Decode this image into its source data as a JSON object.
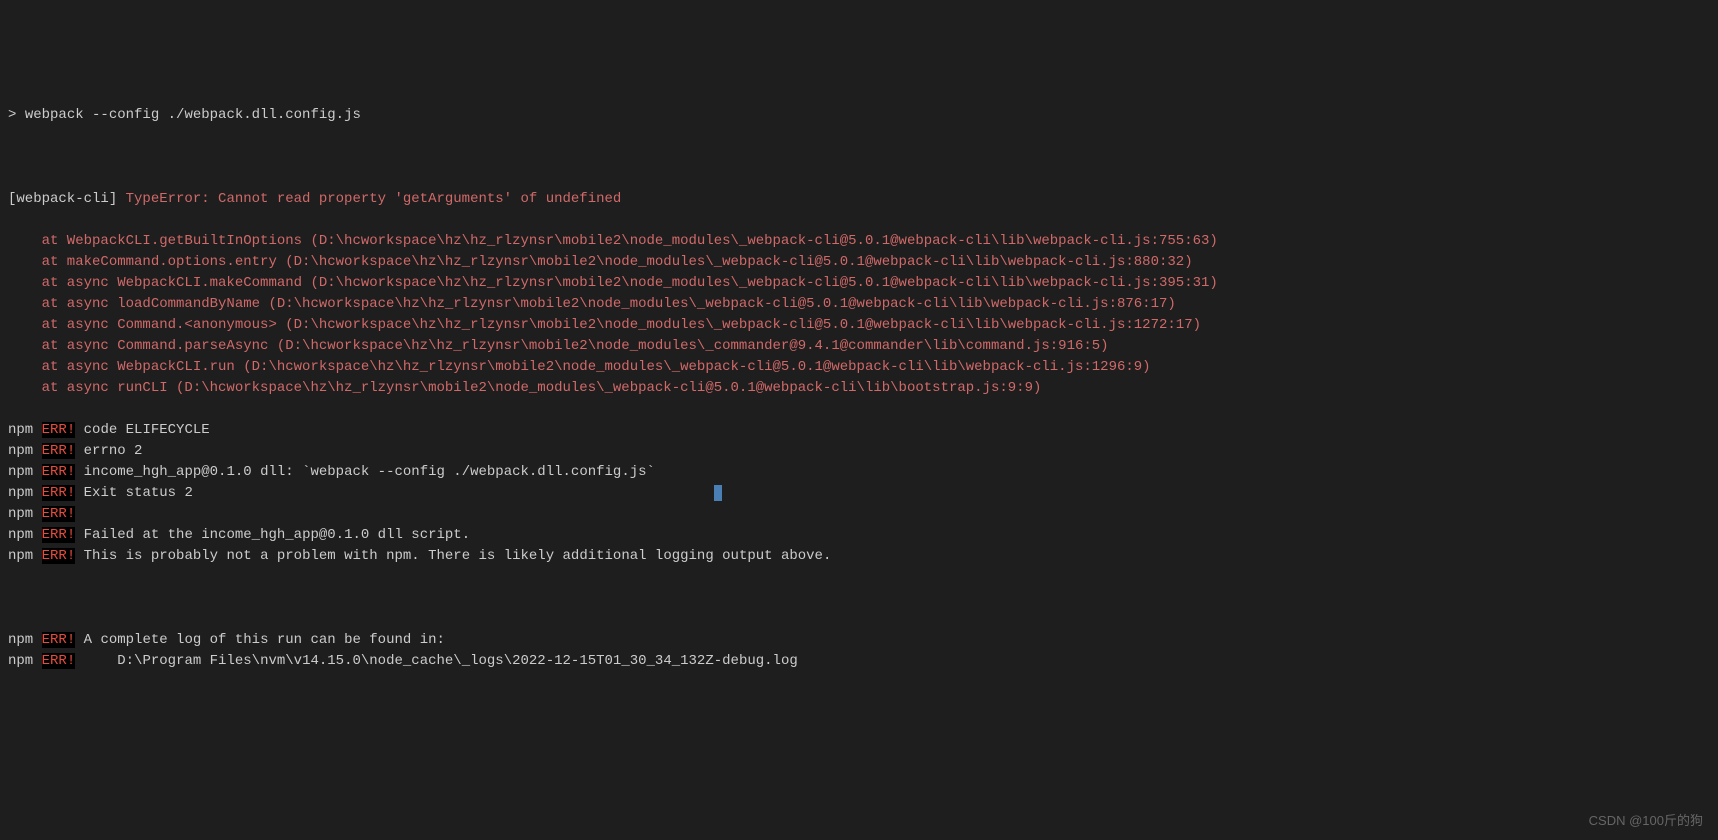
{
  "command": {
    "prompt": ">",
    "text": "webpack --config ./webpack.dll.config.js"
  },
  "webpack_cli": {
    "tag": "[webpack-cli]",
    "error_prefix": "TypeError: Cannot read property 'getArguments' of undefined"
  },
  "stack_traces": [
    "    at WebpackCLI.getBuiltInOptions (D:\\hcworkspace\\hz\\hz_rlzynsr\\mobile2\\node_modules\\_webpack-cli@5.0.1@webpack-cli\\lib\\webpack-cli.js:755:63)",
    "    at makeCommand.options.entry (D:\\hcworkspace\\hz\\hz_rlzynsr\\mobile2\\node_modules\\_webpack-cli@5.0.1@webpack-cli\\lib\\webpack-cli.js:880:32)",
    "    at async WebpackCLI.makeCommand (D:\\hcworkspace\\hz\\hz_rlzynsr\\mobile2\\node_modules\\_webpack-cli@5.0.1@webpack-cli\\lib\\webpack-cli.js:395:31)",
    "    at async loadCommandByName (D:\\hcworkspace\\hz\\hz_rlzynsr\\mobile2\\node_modules\\_webpack-cli@5.0.1@webpack-cli\\lib\\webpack-cli.js:876:17)",
    "    at async Command.<anonymous> (D:\\hcworkspace\\hz\\hz_rlzynsr\\mobile2\\node_modules\\_webpack-cli@5.0.1@webpack-cli\\lib\\webpack-cli.js:1272:17)",
    "    at async Command.parseAsync (D:\\hcworkspace\\hz\\hz_rlzynsr\\mobile2\\node_modules\\_commander@9.4.1@commander\\lib\\command.js:916:5)",
    "    at async WebpackCLI.run (D:\\hcworkspace\\hz\\hz_rlzynsr\\mobile2\\node_modules\\_webpack-cli@5.0.1@webpack-cli\\lib\\webpack-cli.js:1296:9)",
    "    at async runCLI (D:\\hcworkspace\\hz\\hz_rlzynsr\\mobile2\\node_modules\\_webpack-cli@5.0.1@webpack-cli\\lib\\bootstrap.js:9:9)"
  ],
  "npm_errors": [
    {
      "prefix": "npm",
      "label": "ERR!",
      "msg": " code ELIFECYCLE"
    },
    {
      "prefix": "npm",
      "label": "ERR!",
      "msg": " errno 2"
    },
    {
      "prefix": "npm",
      "label": "ERR!",
      "msg": " income_hgh_app@0.1.0 dll: `webpack --config ./webpack.dll.config.js`"
    },
    {
      "prefix": "npm",
      "label": "ERR!",
      "msg": " Exit status 2",
      "cursor": true
    },
    {
      "prefix": "npm",
      "label": "ERR!",
      "msg": ""
    },
    {
      "prefix": "npm",
      "label": "ERR!",
      "msg": " Failed at the income_hgh_app@0.1.0 dll script."
    },
    {
      "prefix": "npm",
      "label": "ERR!",
      "msg": " This is probably not a problem with npm. There is likely additional logging output above."
    }
  ],
  "npm_errors_tail": [
    {
      "prefix": "npm",
      "label": "ERR!",
      "msg": " A complete log of this run can be found in:"
    },
    {
      "prefix": "npm",
      "label": "ERR!",
      "msg": "     D:\\Program Files\\nvm\\v14.15.0\\node_cache\\_logs\\2022-12-15T01_30_34_132Z-debug.log"
    }
  ],
  "watermark": "CSDN @100斤的狗"
}
